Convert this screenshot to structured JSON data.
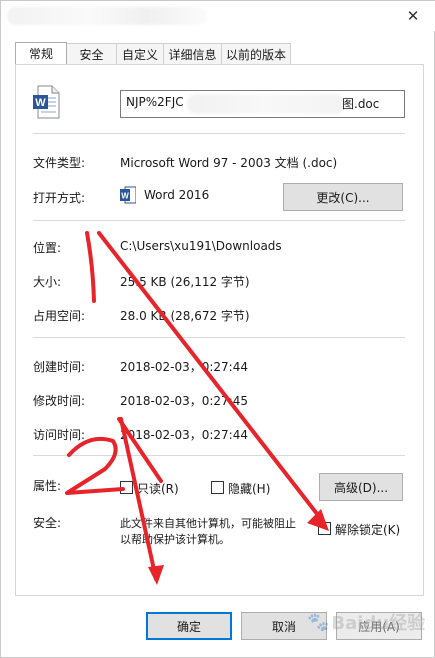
{
  "tabs": [
    {
      "label": "常规"
    },
    {
      "label": "安全"
    },
    {
      "label": "自定义"
    },
    {
      "label": "详细信息"
    },
    {
      "label": "以前的版本"
    }
  ],
  "file": {
    "name_prefix": "NJP%2FJC",
    "name_suffix": "图.doc"
  },
  "rows": {
    "type": {
      "label": "文件类型:",
      "value": "Microsoft Word 97 - 2003 文档 (.doc)"
    },
    "opens_with": {
      "label": "打开方式:",
      "value": "Word 2016",
      "button": "更改(C)..."
    },
    "location": {
      "label": "位置:",
      "value": "C:\\Users\\xu191\\Downloads"
    },
    "size": {
      "label": "大小:",
      "value": "25.5 KB (26,112 字节)"
    },
    "size_on_disk": {
      "label": "占用空间:",
      "value": "28.0 KB (28,672 字节)"
    },
    "created": {
      "label": "创建时间:",
      "value": "2018-02-03，0:27:44"
    },
    "modified": {
      "label": "修改时间:",
      "value": "2018-02-03，0:27:45"
    },
    "accessed": {
      "label": "访问时间:",
      "value": "2018-02-03，0:27:44"
    },
    "attributes": {
      "label": "属性:",
      "readonly": "只读(R)",
      "hidden": "隐藏(H)",
      "advanced": "高级(D)..."
    },
    "security": {
      "label": "安全:",
      "line1": "此文件来自其他计算机，可能被阻止",
      "line2": "以帮助保护该计算机。",
      "unblock": "解除锁定(K)"
    }
  },
  "footer": {
    "ok": "确定",
    "cancel": "取消",
    "apply": "应用(A)"
  },
  "annotations": {
    "mark1": "1",
    "mark2": "2",
    "color": "#e8242b"
  },
  "watermark": "Baidu经验",
  "colors": {
    "accent": "#0078d7",
    "button_face": "#e1e1e1",
    "word_blue": "#2b579a"
  },
  "icons": {
    "close": "close-icon",
    "file": "word-document-icon",
    "app": "word-app-icon"
  }
}
